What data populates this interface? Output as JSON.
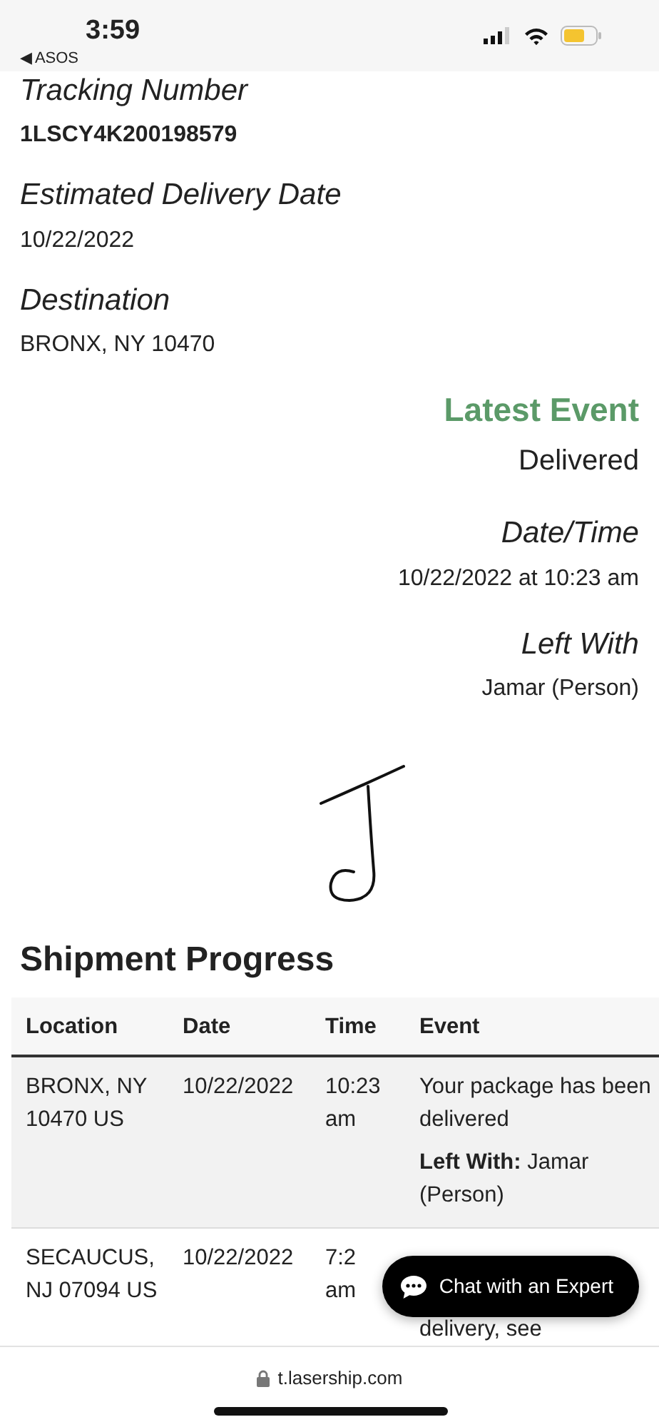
{
  "status_bar": {
    "time": "3:59",
    "back_label": "◀ ASOS"
  },
  "fields": [
    {
      "label": "Tracking Number",
      "value": "1LSCY4K200198579",
      "bold": true
    },
    {
      "label": "Estimated Delivery Date",
      "value": "10/22/2022",
      "bold": false
    },
    {
      "label": "Destination",
      "value": "BRONX, NY 10470",
      "bold": false
    }
  ],
  "latest_event": {
    "title": "Latest Event",
    "status": "Delivered",
    "items": [
      {
        "label": "Date/Time",
        "value": "10/22/2022 at 10:23 am"
      },
      {
        "label": "Left With",
        "value": "Jamar (Person)"
      }
    ]
  },
  "shipment_progress": {
    "title": "Shipment Progress",
    "columns": [
      "Location",
      "Date",
      "Time",
      "Event"
    ],
    "rows": [
      {
        "location": "BRONX, NY 10470 US",
        "date": "10/22/2022",
        "time": [
          "10:23",
          "am"
        ],
        "event": "Your package has been delivered",
        "event_detail": "**Left With:** Jamar (Person)"
      },
      {
        "location": "SECAUCUS, NJ 07094 US",
        "date": "10/22/2022",
        "time": [
          "7:2",
          "am"
        ],
        "event": "delivery, see"
      }
    ]
  },
  "chat_button": "Chat with an Expert",
  "url_bar": "t.lasership.com"
}
